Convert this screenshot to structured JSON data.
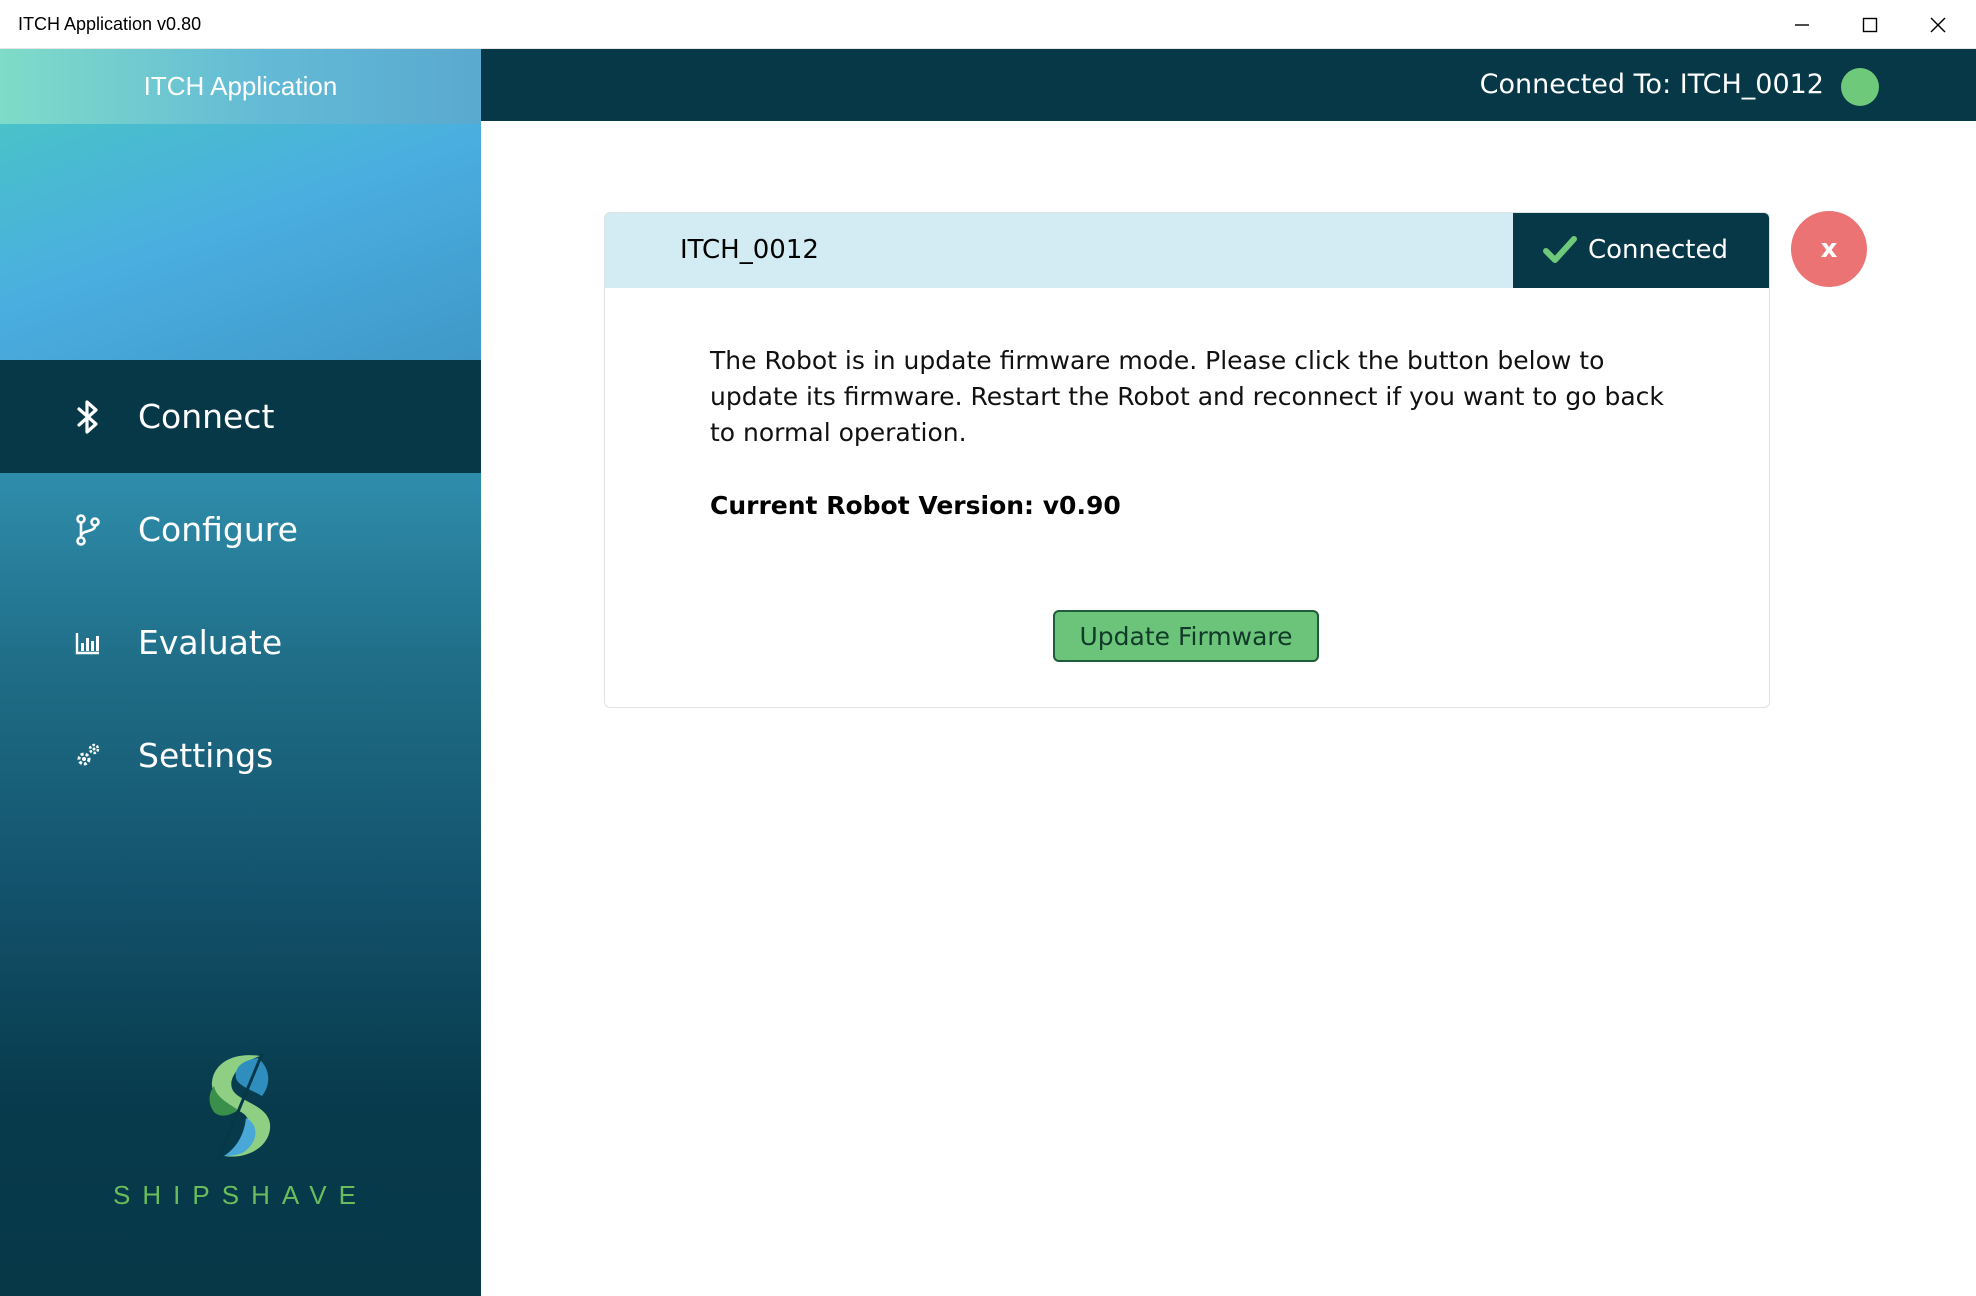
{
  "window": {
    "title": "ITCH Application v0.80"
  },
  "sidebar": {
    "app_name": "ITCH Application",
    "items": [
      {
        "label": "Connect",
        "icon": "bluetooth-icon",
        "active": true
      },
      {
        "label": "Configure",
        "icon": "branch-icon",
        "active": false
      },
      {
        "label": "Evaluate",
        "icon": "chart-icon",
        "active": false
      },
      {
        "label": "Settings",
        "icon": "gears-icon",
        "active": false
      }
    ],
    "brand": "SHIPSHAVE"
  },
  "header": {
    "connection_text": "Connected To: ITCH_0012",
    "status_color": "#6ec97a"
  },
  "card": {
    "device_name": "ITCH_0012",
    "status_label": "Connected",
    "message": "The Robot is in update firmware mode. Please click the button below to update its firmware. Restart the Robot and reconnect if you want to go back to normal operation.",
    "version_text": "Current Robot Version: v0.90",
    "update_button": "Update Firmware",
    "close_label": "x"
  },
  "colors": {
    "dark_teal": "#063848",
    "accent_green": "#6cc47a",
    "close_red": "#ec7374",
    "card_header_bg": "#d3ebf3"
  }
}
